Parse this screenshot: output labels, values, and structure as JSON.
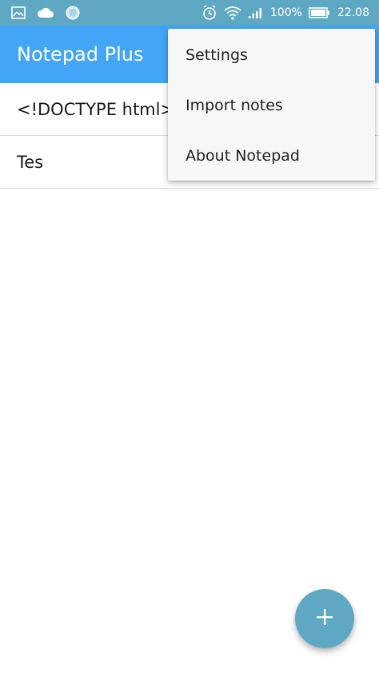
{
  "status_bar": {
    "icons_left": [
      "image-icon",
      "cloud-icon",
      "circle-app-icon"
    ],
    "icons_right": [
      "alarm-icon",
      "wifi-icon",
      "signal-icon"
    ],
    "battery": "100%",
    "time": "22.08"
  },
  "app_bar": {
    "title": "Notepad Plus",
    "color": "#42a5f5"
  },
  "notes": [
    {
      "title": "<!DOCTYPE html>"
    },
    {
      "title": "Tes"
    }
  ],
  "menu": {
    "items": [
      {
        "label": "Settings"
      },
      {
        "label": "Import notes"
      },
      {
        "label": "About Notepad"
      }
    ]
  },
  "fab": {
    "icon": "plus-icon",
    "color": "#5fa8c4"
  }
}
